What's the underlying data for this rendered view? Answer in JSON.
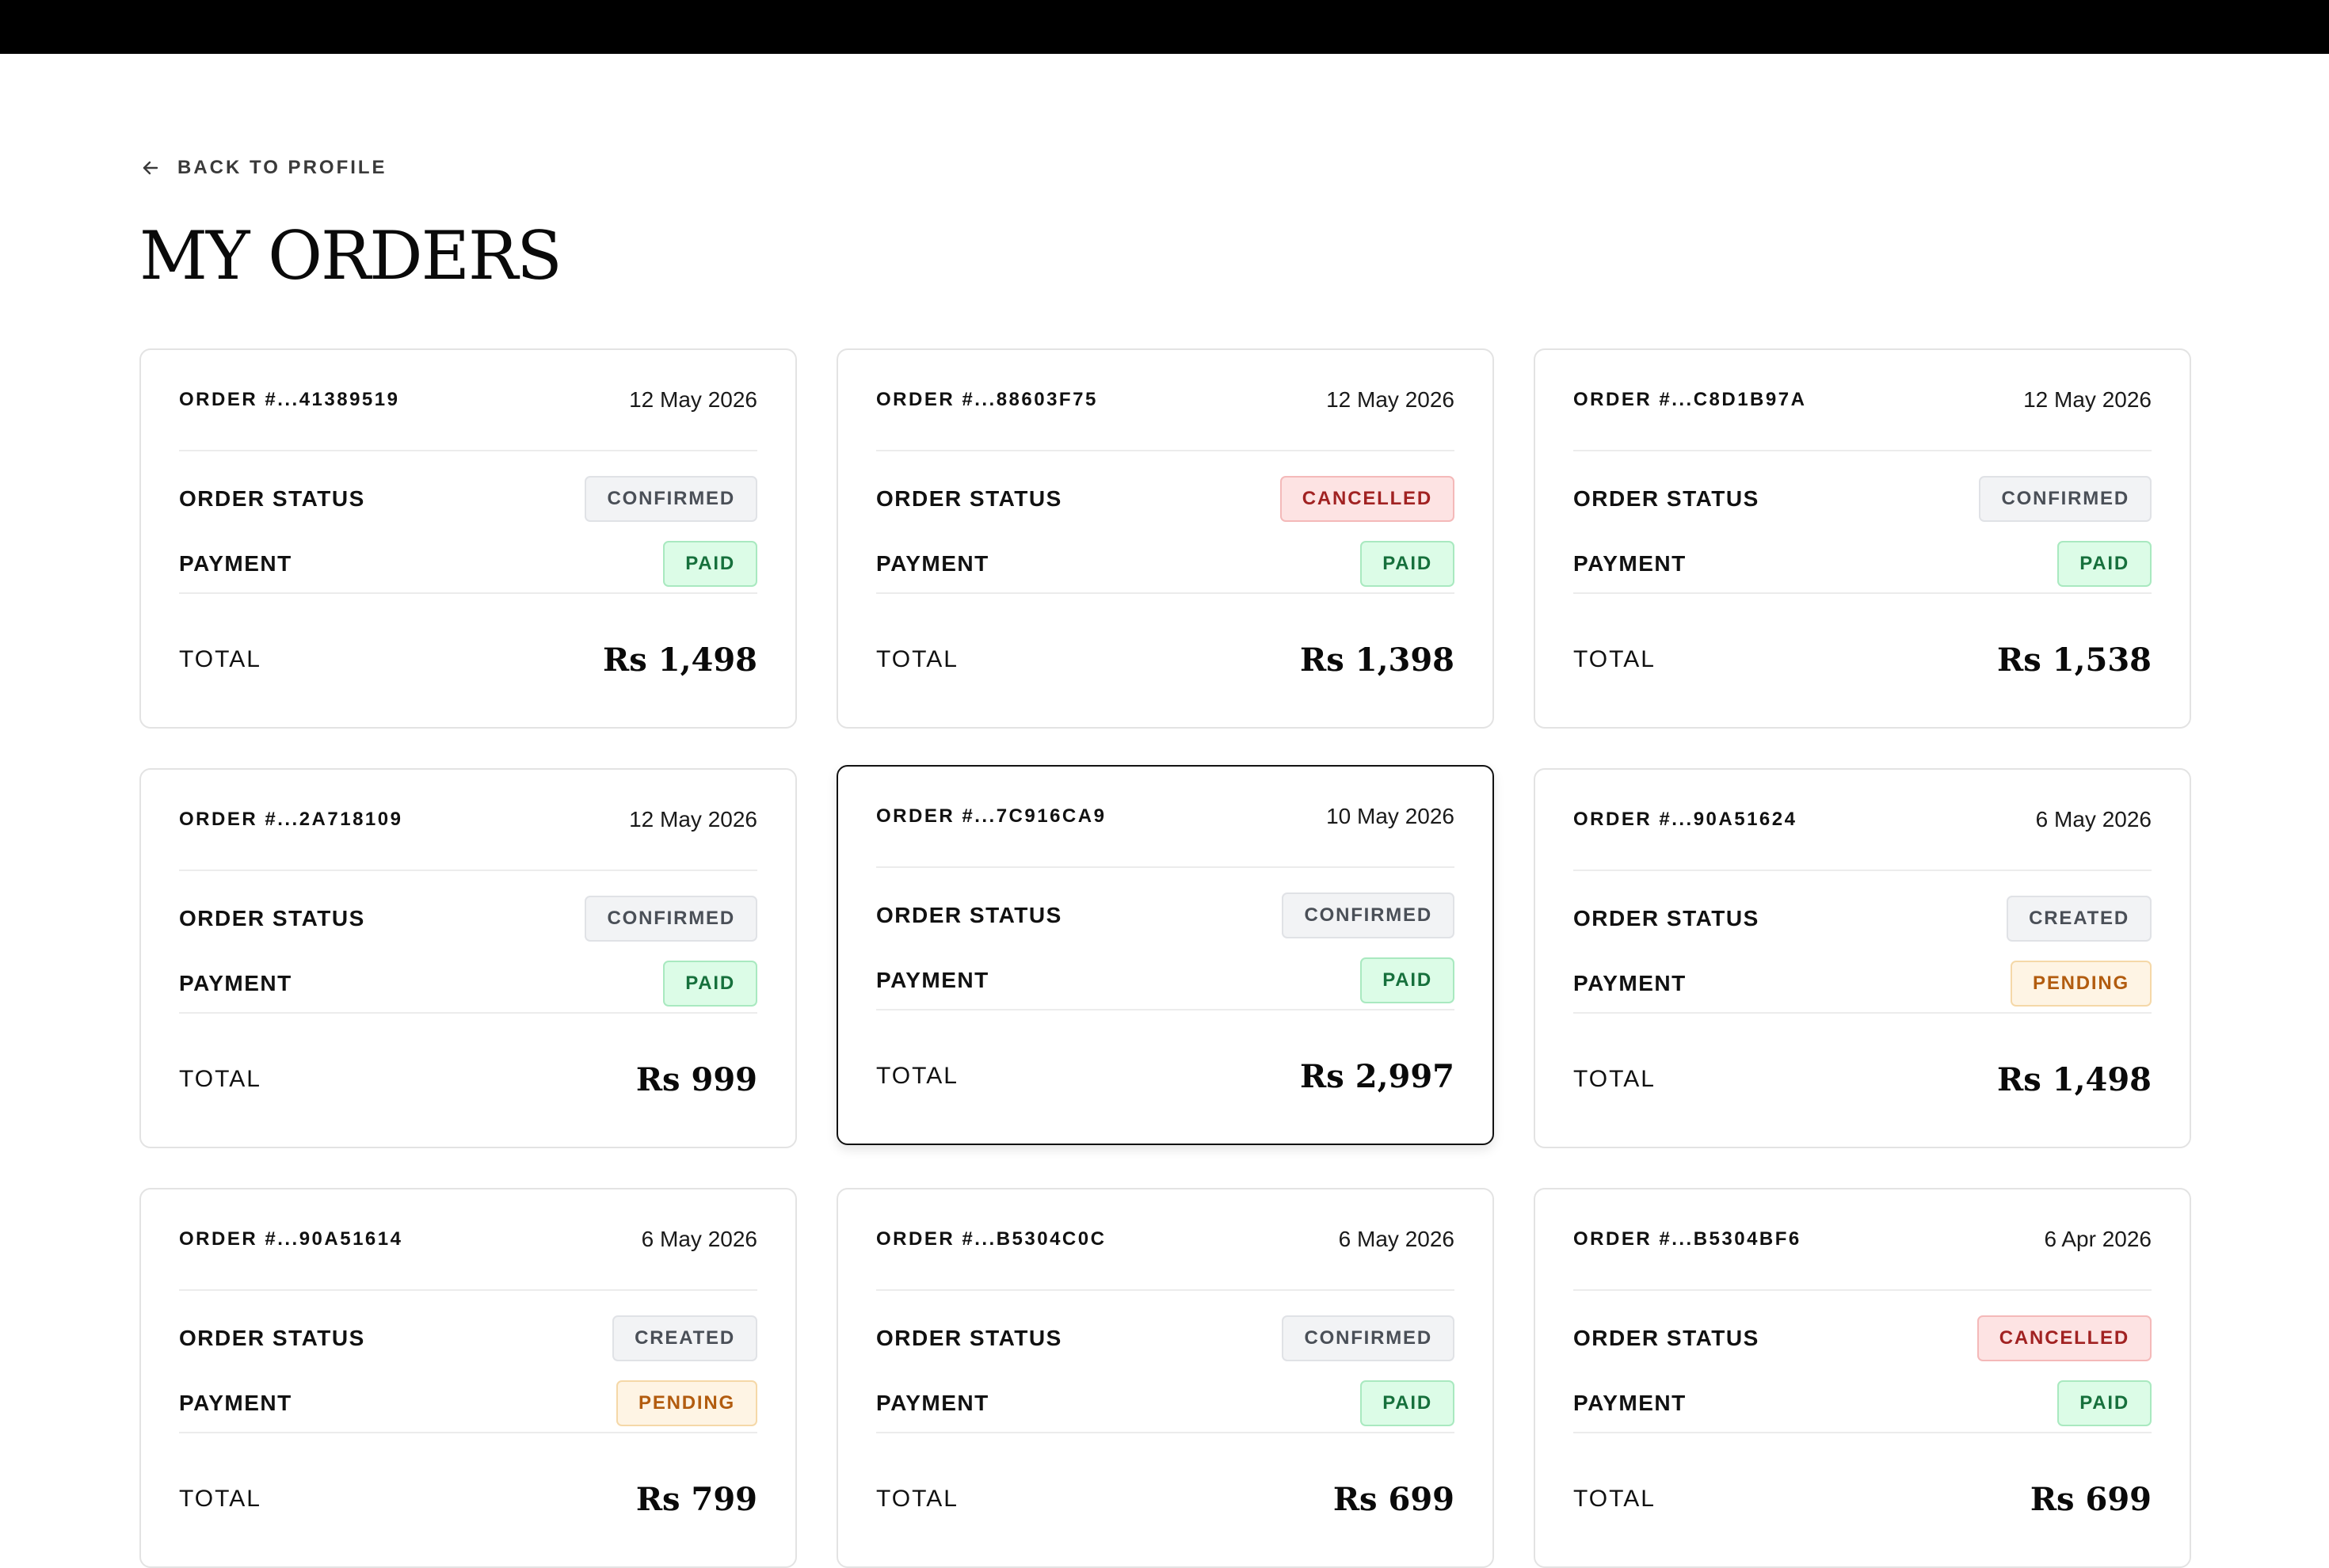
{
  "nav": {
    "back_label": "BACK TO PROFILE"
  },
  "page": {
    "title": "MY ORDERS"
  },
  "labels": {
    "order_status": "ORDER STATUS",
    "payment": "PAYMENT",
    "total": "TOTAL"
  },
  "status_colors": {
    "neutral": "#f2f3f5",
    "cancelled": "#fde3e3",
    "paid": "#dcfce7",
    "pending": "#fef4e4"
  },
  "orders": [
    {
      "id": "ORDER #...41389519",
      "date": "12 May 2026",
      "status": "CONFIRMED",
      "status_tone": "neutral",
      "payment": "PAID",
      "payment_tone": "success",
      "total": "Rs 1,498",
      "selected": false
    },
    {
      "id": "ORDER #...88603F75",
      "date": "12 May 2026",
      "status": "CANCELLED",
      "status_tone": "danger",
      "payment": "PAID",
      "payment_tone": "success",
      "total": "Rs 1,398",
      "selected": false
    },
    {
      "id": "ORDER #...C8D1B97A",
      "date": "12 May 2026",
      "status": "CONFIRMED",
      "status_tone": "neutral",
      "payment": "PAID",
      "payment_tone": "success",
      "total": "Rs 1,538",
      "selected": false
    },
    {
      "id": "ORDER #...2A718109",
      "date": "12 May 2026",
      "status": "CONFIRMED",
      "status_tone": "neutral",
      "payment": "PAID",
      "payment_tone": "success",
      "total": "Rs 999",
      "selected": false
    },
    {
      "id": "ORDER #...7C916CA9",
      "date": "10 May 2026",
      "status": "CONFIRMED",
      "status_tone": "neutral",
      "payment": "PAID",
      "payment_tone": "success",
      "total": "Rs 2,997",
      "selected": true
    },
    {
      "id": "ORDER #...90A51624",
      "date": "6 May 2026",
      "status": "CREATED",
      "status_tone": "neutral",
      "payment": "PENDING",
      "payment_tone": "warning",
      "total": "Rs 1,498",
      "selected": false
    },
    {
      "id": "ORDER #...90A51614",
      "date": "6 May 2026",
      "status": "CREATED",
      "status_tone": "neutral",
      "payment": "PENDING",
      "payment_tone": "warning",
      "total": "Rs 799",
      "selected": false
    },
    {
      "id": "ORDER #...B5304C0C",
      "date": "6 May 2026",
      "status": "CONFIRMED",
      "status_tone": "neutral",
      "payment": "PAID",
      "payment_tone": "success",
      "total": "Rs 699",
      "selected": false
    },
    {
      "id": "ORDER #...B5304BF6",
      "date": "6 Apr 2026",
      "status": "CANCELLED",
      "status_tone": "danger",
      "payment": "PAID",
      "payment_tone": "success",
      "total": "Rs 699",
      "selected": false
    }
  ]
}
